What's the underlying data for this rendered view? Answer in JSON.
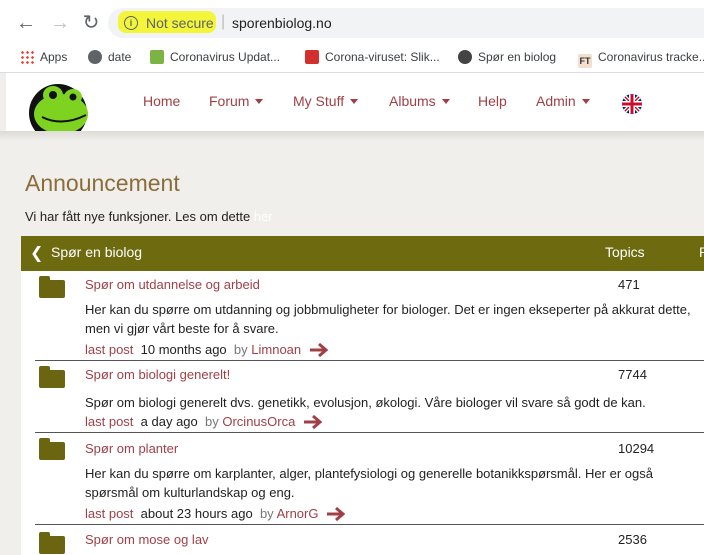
{
  "browser": {
    "security_label": "Not secure",
    "url": "sporenbiolog.no"
  },
  "bookmarks": [
    {
      "label": "Apps",
      "icon": "apps-grid-icon"
    },
    {
      "label": "date",
      "icon": "globe-icon"
    },
    {
      "label": "Coronavirus Updat...",
      "icon": "worldometer-icon"
    },
    {
      "label": "Corona-viruset: Slik...",
      "icon": "vg-icon"
    },
    {
      "label": "Spør en biolog",
      "icon": "frog-icon"
    },
    {
      "label": "Coronavirus tracke...",
      "icon": "ft-icon"
    }
  ],
  "nav": {
    "items": [
      {
        "label": "Home",
        "dropdown": false
      },
      {
        "label": "Forum",
        "dropdown": true
      },
      {
        "label": "My Stuff",
        "dropdown": true
      },
      {
        "label": "Albums",
        "dropdown": true
      },
      {
        "label": "Help",
        "dropdown": false
      },
      {
        "label": "Admin",
        "dropdown": true
      }
    ],
    "language_icon": "uk-flag-icon"
  },
  "announcement": {
    "title": "Announcement",
    "text": "Vi har fått nye funksjoner. Les om dette ",
    "link": "her"
  },
  "forum": {
    "title": "Spør en biolog",
    "col_topics": "Topics",
    "col_truncated": "P",
    "last_post_label": "last post",
    "by_label": "by",
    "rows": [
      {
        "title": "Spør om utdannelse og arbeid",
        "topics": "471",
        "description": "Her kan du spørre om utdanning og jobbmuligheter for biologer. Det er ingen ekseperter på akkurat dette, men vi gjør vårt beste for å svare.",
        "last_post_time": "10 months ago",
        "author": "Limnoan"
      },
      {
        "title": "Spør om biologi generelt!",
        "topics": "7744",
        "description": "Spør om biologi generelt dvs. genetikk, evolusjon, økologi. Våre biologer vil svare så godt de kan.",
        "last_post_time": "a day ago",
        "author": "OrcinusOrca"
      },
      {
        "title": "Spør om planter",
        "topics": "10294",
        "description": "Her kan du spørre om karplanter, alger, plantefysiologi og generelle botanikkspørsmål. Her er også spørsmål om kulturlandskap og eng.",
        "last_post_time": "about 23 hours ago",
        "author": "ArnorG"
      },
      {
        "title": "Spør om mose og lav",
        "topics": "2536"
      }
    ]
  },
  "colors": {
    "accent": "#a04046",
    "forum_header": "#6e6a0f",
    "heading": "#8b6d3a"
  }
}
